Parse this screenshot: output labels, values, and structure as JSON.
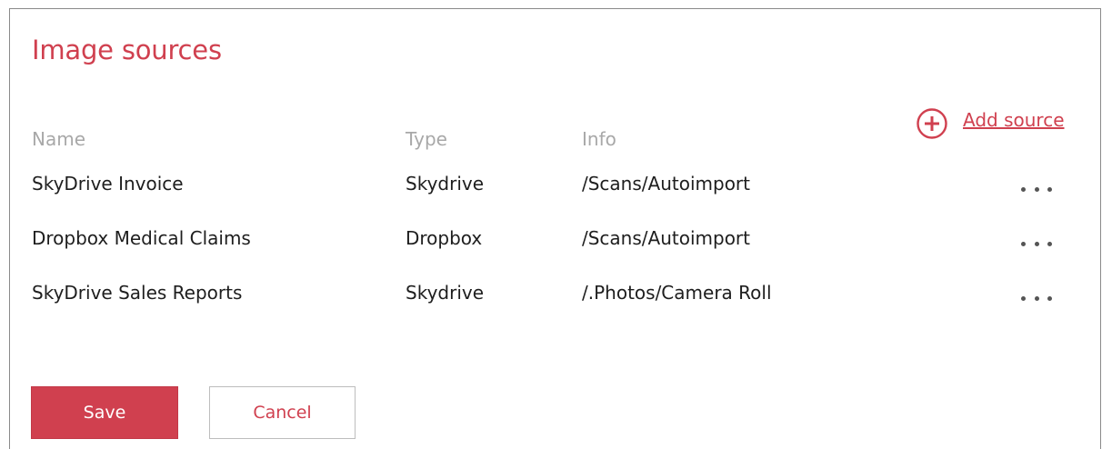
{
  "dialog": {
    "title": "Image sources",
    "add_source_label": "Add source",
    "columns": {
      "name": "Name",
      "type": "Type",
      "info": "Info"
    },
    "rows": [
      {
        "name": "SkyDrive Invoice",
        "type": "Skydrive",
        "info": "/Scans/Autoimport"
      },
      {
        "name": "Dropbox Medical Claims",
        "type": "Dropbox",
        "info": "/Scans/Autoimport"
      },
      {
        "name": "SkyDrive Sales Reports",
        "type": "Skydrive",
        "info": "/.Photos/Camera Roll"
      }
    ],
    "save_label": "Save",
    "cancel_label": "Cancel"
  },
  "icons": {
    "add": "plus-circle-icon",
    "row_menu": "more-horizontal-icon"
  },
  "colors": {
    "accent": "#d0404f",
    "header_text": "#a8a8a8",
    "body_text": "#1e1e1e",
    "border": "#8a8a8a"
  }
}
